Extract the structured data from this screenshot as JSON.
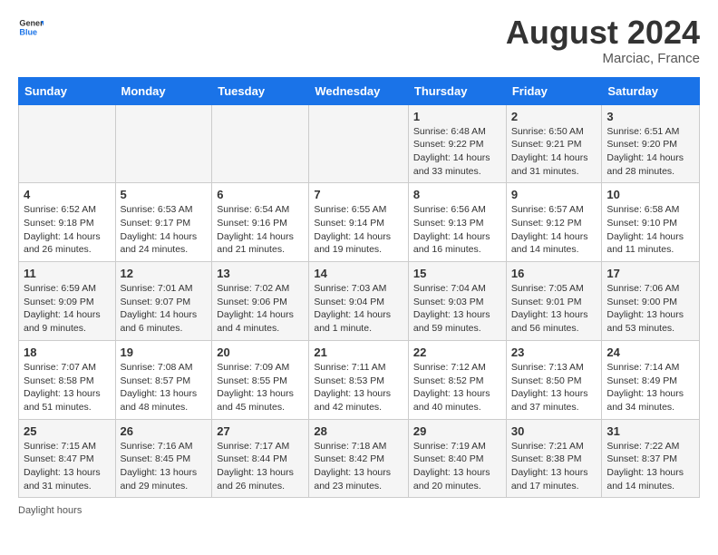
{
  "header": {
    "logo_general": "General",
    "logo_blue": "Blue",
    "month_year": "August 2024",
    "location": "Marciac, France"
  },
  "days_of_week": [
    "Sunday",
    "Monday",
    "Tuesday",
    "Wednesday",
    "Thursday",
    "Friday",
    "Saturday"
  ],
  "weeks": [
    [
      {
        "day": "",
        "info": ""
      },
      {
        "day": "",
        "info": ""
      },
      {
        "day": "",
        "info": ""
      },
      {
        "day": "",
        "info": ""
      },
      {
        "day": "1",
        "info": "Sunrise: 6:48 AM\nSunset: 9:22 PM\nDaylight: 14 hours\nand 33 minutes."
      },
      {
        "day": "2",
        "info": "Sunrise: 6:50 AM\nSunset: 9:21 PM\nDaylight: 14 hours\nand 31 minutes."
      },
      {
        "day": "3",
        "info": "Sunrise: 6:51 AM\nSunset: 9:20 PM\nDaylight: 14 hours\nand 28 minutes."
      }
    ],
    [
      {
        "day": "4",
        "info": "Sunrise: 6:52 AM\nSunset: 9:18 PM\nDaylight: 14 hours\nand 26 minutes."
      },
      {
        "day": "5",
        "info": "Sunrise: 6:53 AM\nSunset: 9:17 PM\nDaylight: 14 hours\nand 24 minutes."
      },
      {
        "day": "6",
        "info": "Sunrise: 6:54 AM\nSunset: 9:16 PM\nDaylight: 14 hours\nand 21 minutes."
      },
      {
        "day": "7",
        "info": "Sunrise: 6:55 AM\nSunset: 9:14 PM\nDaylight: 14 hours\nand 19 minutes."
      },
      {
        "day": "8",
        "info": "Sunrise: 6:56 AM\nSunset: 9:13 PM\nDaylight: 14 hours\nand 16 minutes."
      },
      {
        "day": "9",
        "info": "Sunrise: 6:57 AM\nSunset: 9:12 PM\nDaylight: 14 hours\nand 14 minutes."
      },
      {
        "day": "10",
        "info": "Sunrise: 6:58 AM\nSunset: 9:10 PM\nDaylight: 14 hours\nand 11 minutes."
      }
    ],
    [
      {
        "day": "11",
        "info": "Sunrise: 6:59 AM\nSunset: 9:09 PM\nDaylight: 14 hours\nand 9 minutes."
      },
      {
        "day": "12",
        "info": "Sunrise: 7:01 AM\nSunset: 9:07 PM\nDaylight: 14 hours\nand 6 minutes."
      },
      {
        "day": "13",
        "info": "Sunrise: 7:02 AM\nSunset: 9:06 PM\nDaylight: 14 hours\nand 4 minutes."
      },
      {
        "day": "14",
        "info": "Sunrise: 7:03 AM\nSunset: 9:04 PM\nDaylight: 14 hours\nand 1 minute."
      },
      {
        "day": "15",
        "info": "Sunrise: 7:04 AM\nSunset: 9:03 PM\nDaylight: 13 hours\nand 59 minutes."
      },
      {
        "day": "16",
        "info": "Sunrise: 7:05 AM\nSunset: 9:01 PM\nDaylight: 13 hours\nand 56 minutes."
      },
      {
        "day": "17",
        "info": "Sunrise: 7:06 AM\nSunset: 9:00 PM\nDaylight: 13 hours\nand 53 minutes."
      }
    ],
    [
      {
        "day": "18",
        "info": "Sunrise: 7:07 AM\nSunset: 8:58 PM\nDaylight: 13 hours\nand 51 minutes."
      },
      {
        "day": "19",
        "info": "Sunrise: 7:08 AM\nSunset: 8:57 PM\nDaylight: 13 hours\nand 48 minutes."
      },
      {
        "day": "20",
        "info": "Sunrise: 7:09 AM\nSunset: 8:55 PM\nDaylight: 13 hours\nand 45 minutes."
      },
      {
        "day": "21",
        "info": "Sunrise: 7:11 AM\nSunset: 8:53 PM\nDaylight: 13 hours\nand 42 minutes."
      },
      {
        "day": "22",
        "info": "Sunrise: 7:12 AM\nSunset: 8:52 PM\nDaylight: 13 hours\nand 40 minutes."
      },
      {
        "day": "23",
        "info": "Sunrise: 7:13 AM\nSunset: 8:50 PM\nDaylight: 13 hours\nand 37 minutes."
      },
      {
        "day": "24",
        "info": "Sunrise: 7:14 AM\nSunset: 8:49 PM\nDaylight: 13 hours\nand 34 minutes."
      }
    ],
    [
      {
        "day": "25",
        "info": "Sunrise: 7:15 AM\nSunset: 8:47 PM\nDaylight: 13 hours\nand 31 minutes."
      },
      {
        "day": "26",
        "info": "Sunrise: 7:16 AM\nSunset: 8:45 PM\nDaylight: 13 hours\nand 29 minutes."
      },
      {
        "day": "27",
        "info": "Sunrise: 7:17 AM\nSunset: 8:44 PM\nDaylight: 13 hours\nand 26 minutes."
      },
      {
        "day": "28",
        "info": "Sunrise: 7:18 AM\nSunset: 8:42 PM\nDaylight: 13 hours\nand 23 minutes."
      },
      {
        "day": "29",
        "info": "Sunrise: 7:19 AM\nSunset: 8:40 PM\nDaylight: 13 hours\nand 20 minutes."
      },
      {
        "day": "30",
        "info": "Sunrise: 7:21 AM\nSunset: 8:38 PM\nDaylight: 13 hours\nand 17 minutes."
      },
      {
        "day": "31",
        "info": "Sunrise: 7:22 AM\nSunset: 8:37 PM\nDaylight: 13 hours\nand 14 minutes."
      }
    ]
  ],
  "footer": {
    "note": "Daylight hours"
  }
}
